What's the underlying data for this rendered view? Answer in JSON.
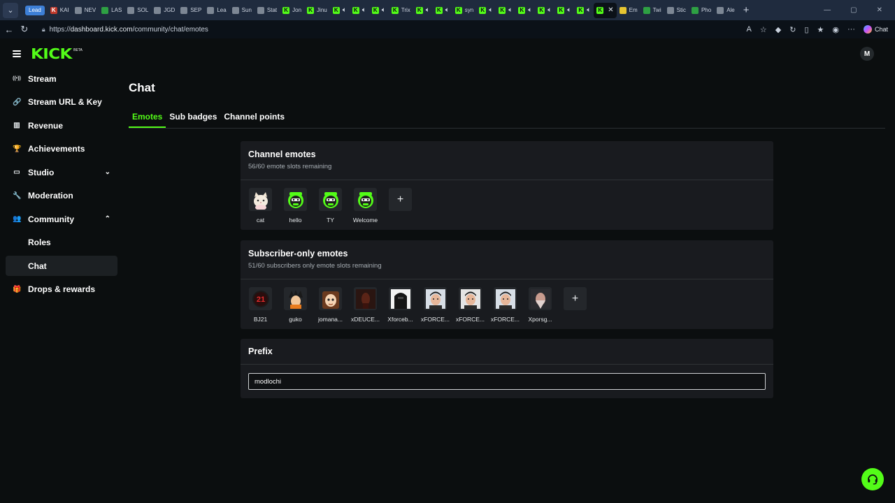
{
  "browser": {
    "tabs": [
      {
        "label": "Lead",
        "favicon": "lead-badge",
        "active": false
      },
      {
        "label": "KAI",
        "favicon": "red-k",
        "active": false
      },
      {
        "label": "NEV",
        "favicon": "grey",
        "active": false
      },
      {
        "label": "LAS",
        "favicon": "green",
        "active": false
      },
      {
        "label": "SOL",
        "favicon": "grey",
        "active": false
      },
      {
        "label": "JGD",
        "favicon": "grey",
        "active": false
      },
      {
        "label": "SEP",
        "favicon": "grey",
        "active": false
      },
      {
        "label": "Lea",
        "favicon": "grey",
        "active": false
      },
      {
        "label": "Sun",
        "favicon": "grey",
        "active": false
      },
      {
        "label": "Stat",
        "favicon": "grey",
        "active": false
      },
      {
        "label": "Jon",
        "favicon": "kick",
        "active": false
      },
      {
        "label": "Jinu",
        "favicon": "kick",
        "active": false
      },
      {
        "label": "",
        "favicon": "kick-audio",
        "active": false
      },
      {
        "label": "",
        "favicon": "kick-audio",
        "active": false
      },
      {
        "label": "",
        "favicon": "kick-audio",
        "active": false
      },
      {
        "label": "Trix",
        "favicon": "kick",
        "active": false
      },
      {
        "label": "",
        "favicon": "kick-audio",
        "active": false
      },
      {
        "label": "",
        "favicon": "kick-audio",
        "active": false
      },
      {
        "label": "syn",
        "favicon": "kick",
        "active": false
      },
      {
        "label": "",
        "favicon": "kick-audio",
        "active": false
      },
      {
        "label": "",
        "favicon": "kick-audio",
        "active": false
      },
      {
        "label": "",
        "favicon": "kick-audio",
        "active": false
      },
      {
        "label": "",
        "favicon": "kick-audio",
        "active": false
      },
      {
        "label": "",
        "favicon": "kick-audio",
        "active": false
      },
      {
        "label": "",
        "favicon": "kick-audio",
        "active": false
      },
      {
        "label": "",
        "favicon": "kick",
        "active": true
      },
      {
        "label": "Em",
        "favicon": "yellow",
        "active": false
      },
      {
        "label": "Twi",
        "favicon": "green",
        "active": false
      },
      {
        "label": "Stic",
        "favicon": "grey",
        "active": false
      },
      {
        "label": "Pho",
        "favicon": "green",
        "active": false
      },
      {
        "label": "Ale",
        "favicon": "grey",
        "active": false
      }
    ],
    "url_prefix": "https://",
    "url_host": "dashboard.kick.com",
    "url_path": "/community/chat/emotes",
    "copilot_label": "Chat"
  },
  "app": {
    "logo_text": "KICK",
    "logo_badge": "BETA",
    "avatar_initials": "M"
  },
  "sidebar": {
    "items": [
      {
        "label": "Stream",
        "icon": "broadcast-icon",
        "glyph": "((•))",
        "sub": false,
        "selected": false,
        "chevron": ""
      },
      {
        "label": "Stream URL & Key",
        "icon": "link-icon",
        "glyph": "🔗",
        "sub": false,
        "selected": false,
        "chevron": ""
      },
      {
        "label": "Revenue",
        "icon": "chart-icon",
        "glyph": "▥",
        "sub": false,
        "selected": false,
        "chevron": ""
      },
      {
        "label": "Achievements",
        "icon": "trophy-icon",
        "glyph": "🏆",
        "sub": false,
        "selected": false,
        "chevron": ""
      },
      {
        "label": "Studio",
        "icon": "studio-icon",
        "glyph": "▭",
        "sub": false,
        "selected": false,
        "chevron": "⌄"
      },
      {
        "label": "Moderation",
        "icon": "wrench-icon",
        "glyph": "🔧",
        "sub": false,
        "selected": false,
        "chevron": ""
      },
      {
        "label": "Community",
        "icon": "community-icon",
        "glyph": "👥",
        "sub": false,
        "selected": false,
        "chevron": "⌃"
      },
      {
        "label": "Roles",
        "icon": "",
        "glyph": "",
        "sub": true,
        "selected": false,
        "chevron": ""
      },
      {
        "label": "Chat",
        "icon": "",
        "glyph": "",
        "sub": true,
        "selected": true,
        "chevron": ""
      },
      {
        "label": "Drops & rewards",
        "icon": "gift-icon",
        "glyph": "🎁",
        "sub": false,
        "selected": false,
        "chevron": ""
      }
    ]
  },
  "page": {
    "title": "Chat",
    "tabs": [
      {
        "label": "Emotes",
        "active": true
      },
      {
        "label": "Sub badges",
        "active": false
      },
      {
        "label": "Channel points",
        "active": false
      }
    ]
  },
  "channel_emotes": {
    "title": "Channel emotes",
    "subtitle": "56/60 emote slots remaining",
    "emotes": [
      {
        "label": "cat",
        "style": "cat"
      },
      {
        "label": "hello",
        "style": "bot-hello"
      },
      {
        "label": "TY",
        "style": "bot-ty"
      },
      {
        "label": "Welcome",
        "style": "bot-welcome"
      }
    ],
    "add_label": "+"
  },
  "subscriber_emotes": {
    "title": "Subscriber-only emotes",
    "subtitle": "51/60 subscribers only emote slots remaining",
    "emotes": [
      {
        "label": "BJ21",
        "style": "bj21"
      },
      {
        "label": "guko",
        "style": "guko"
      },
      {
        "label": "jomana...",
        "style": "jomana"
      },
      {
        "label": "xDEUCE...",
        "style": "xdeuce"
      },
      {
        "label": "Xforceb...",
        "style": "xforceb"
      },
      {
        "label": "xFORCE...",
        "style": "face1"
      },
      {
        "label": "xFORCE...",
        "style": "face2"
      },
      {
        "label": "xFORCE...",
        "style": "face3"
      },
      {
        "label": "Xporsg...",
        "style": "xporsg"
      }
    ],
    "add_label": "+"
  },
  "prefix": {
    "title": "Prefix",
    "value": "modlochi"
  },
  "colors": {
    "accent": "#53fc18",
    "background": "#0b0e0f",
    "card": "#191b1f"
  }
}
